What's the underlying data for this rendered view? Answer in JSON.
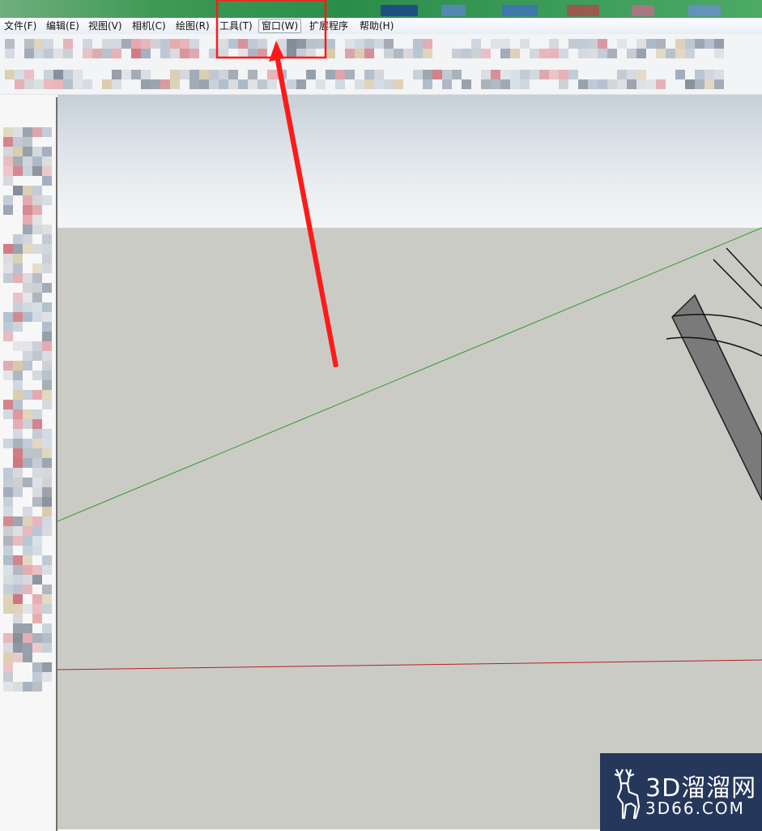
{
  "menubar": {
    "items": [
      {
        "label": "文件(F)"
      },
      {
        "label": "编辑(E)"
      },
      {
        "label": "视图(V)"
      },
      {
        "label": "相机(C)"
      },
      {
        "label": "绘图(R)"
      },
      {
        "label": "工具(T)"
      },
      {
        "label": "窗口(W)"
      },
      {
        "label": "扩展程序"
      },
      {
        "label": "帮助(H)"
      }
    ],
    "highlighted_item": "窗口(W)"
  },
  "annotation": {
    "box_color": "#ff1a1a",
    "arrow_color": "#ff1a1a"
  },
  "viewport": {
    "green_axis_color": "#2e9b2e",
    "red_axis_color": "#b22020",
    "ground_color": "#cbcbc6"
  },
  "watermark": {
    "brand": "3D溜溜网",
    "url": "3D66.COM",
    "icon": "deer-logo-icon"
  }
}
